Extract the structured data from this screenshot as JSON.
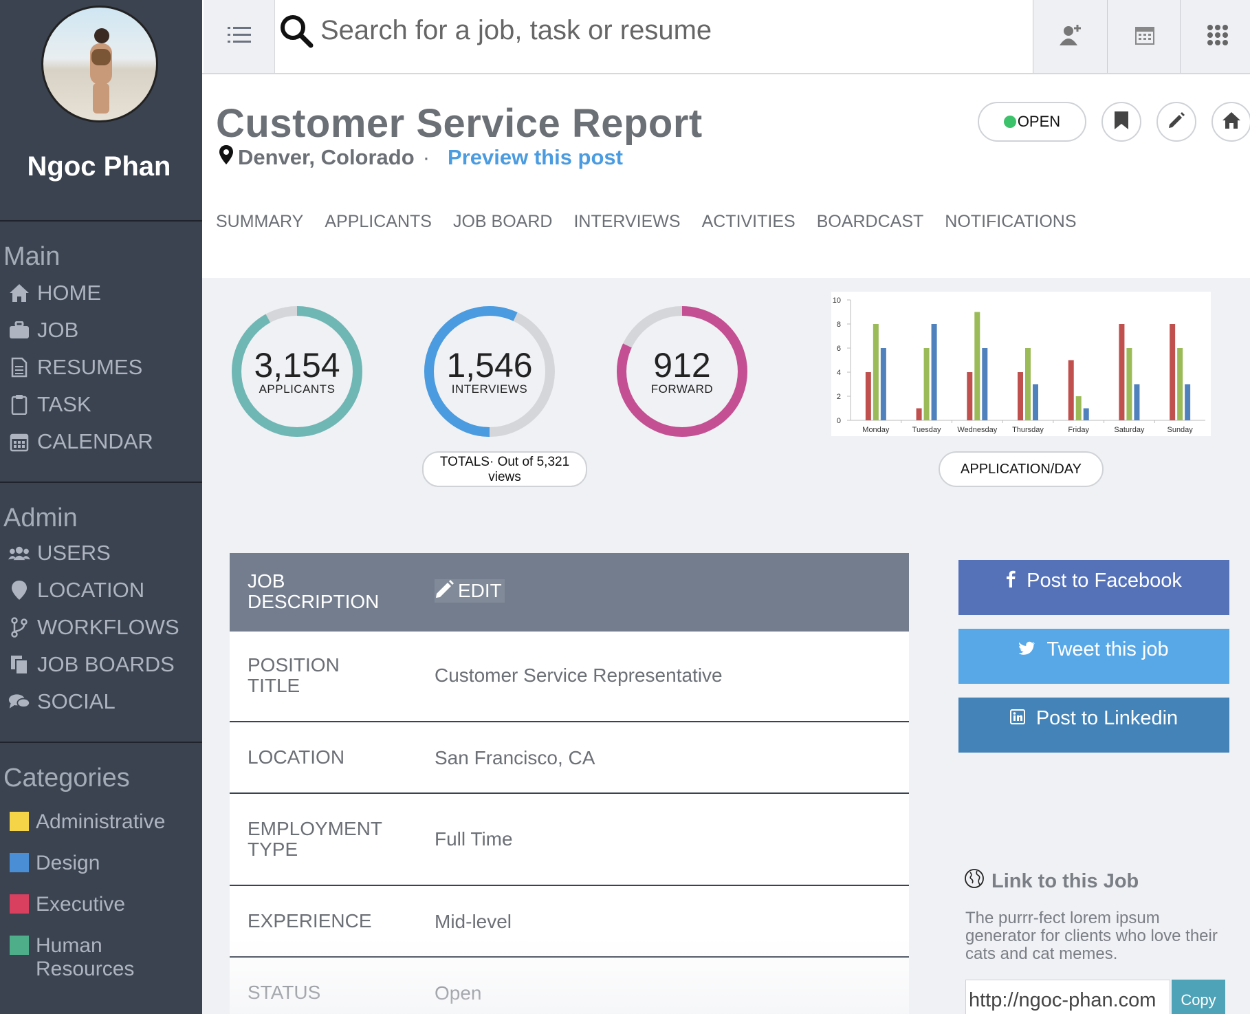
{
  "user": {
    "name": "Ngoc Phan"
  },
  "search": {
    "placeholder": "Search for a job, task or resume"
  },
  "sidebar": {
    "main_heading": "Main",
    "main_items": [
      {
        "label": "HOME",
        "icon": "home-icon"
      },
      {
        "label": "JOB",
        "icon": "briefcase-icon"
      },
      {
        "label": "RESUMES",
        "icon": "document-icon"
      },
      {
        "label": "TASK",
        "icon": "clipboard-icon"
      },
      {
        "label": "CALENDAR",
        "icon": "calendar-icon"
      }
    ],
    "admin_heading": "Admin",
    "admin_items": [
      {
        "label": "USERS",
        "icon": "users-icon"
      },
      {
        "label": "LOCATION",
        "icon": "map-pin-icon"
      },
      {
        "label": "WORKFLOWS",
        "icon": "branch-icon"
      },
      {
        "label": "JOB BOARDS",
        "icon": "files-icon"
      },
      {
        "label": "SOCIAL",
        "icon": "chat-icon"
      }
    ],
    "categories_heading": "Categories",
    "categories": [
      {
        "label": "Administrative",
        "color": "#f5d547"
      },
      {
        "label": "Design",
        "color": "#4a8fd6"
      },
      {
        "label": "Executive",
        "color": "#d9405f"
      },
      {
        "label": "Human Resources",
        "color": "#4fae8a"
      }
    ]
  },
  "header": {
    "title": "Customer Service Report",
    "location": "Denver, Colorado",
    "separator": "·",
    "preview_link": "Preview this post",
    "status": "OPEN",
    "status_color": "#3cc26a"
  },
  "tabs": [
    "SUMMARY",
    "APPLICANTS",
    "JOB BOARD",
    "INTERVIEWS",
    "ACTIVITIES",
    "BOARDCAST",
    "NOTIFICATIONS"
  ],
  "stats": [
    {
      "value": "3,154",
      "label": "APPLICANTS",
      "fraction": 0.92,
      "color": "#6fb7b5"
    },
    {
      "value": "1,546",
      "label": "INTERVIEWS",
      "fraction": 0.57,
      "color": "#4a9be0"
    },
    {
      "value": "912",
      "label": "FORWARD",
      "fraction": 0.82,
      "color": "#c44f93"
    }
  ],
  "totals_text": "TOTALS· Out of 5,321 views",
  "chart_button": "APPLICATION/DAY",
  "chart_data": {
    "type": "bar",
    "categories": [
      "Monday",
      "Tuesday",
      "Wednesday",
      "Thursday",
      "Friday",
      "Saturday",
      "Sunday"
    ],
    "series": [
      {
        "values": [
          4,
          1,
          4,
          4,
          5,
          8,
          8
        ],
        "color": "#c0504d"
      },
      {
        "values": [
          8,
          6,
          9,
          6,
          2,
          6,
          6
        ],
        "color": "#9bbb59"
      },
      {
        "values": [
          6,
          8,
          6,
          3,
          1,
          3,
          3
        ],
        "color": "#4f81bd"
      }
    ],
    "ylim": [
      0,
      10
    ],
    "yticks": [
      0,
      2,
      4,
      6,
      8,
      10
    ],
    "grid": false
  },
  "job_description": {
    "heading": "JOB DESCRIPTION",
    "edit_label": "EDIT",
    "rows": [
      {
        "key": "POSITION TITLE",
        "value": "Customer Service Representative"
      },
      {
        "key": "LOCATION",
        "value": "San Francisco, CA"
      },
      {
        "key": "EMPLOYMENT TYPE",
        "value": "Full Time"
      },
      {
        "key": "EXPERIENCE",
        "value": "Mid-level"
      },
      {
        "key": "STATUS",
        "value": "Open"
      }
    ]
  },
  "social": [
    {
      "label": "Post to Facebook",
      "icon": "facebook-icon",
      "color": "#5572b9"
    },
    {
      "label": "Tweet this job",
      "icon": "twitter-icon",
      "color": "#58a8e8"
    },
    {
      "label": "Post to Linkedin",
      "icon": "linkedin-icon",
      "color": "#4483b8"
    }
  ],
  "link_section": {
    "title": "Link to this Job",
    "description": "The purrr-fect lorem ipsum generator for clients who love their cats and cat memes.",
    "url": "http://ngoc-phan.com",
    "copy_label": "Copy"
  }
}
